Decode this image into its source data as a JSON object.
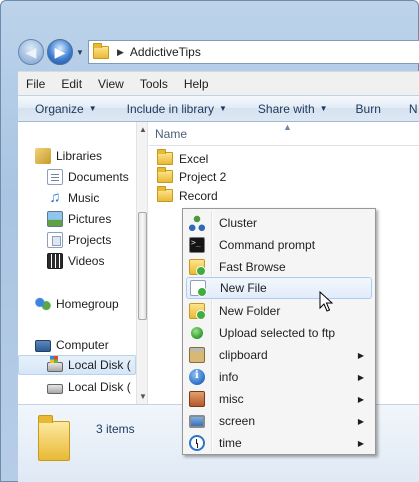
{
  "window": {
    "address": {
      "path_label": "AddictiveTips"
    },
    "menubar": [
      "File",
      "Edit",
      "View",
      "Tools",
      "Help"
    ],
    "commandbar": [
      {
        "label": "Organize",
        "dropdown": true
      },
      {
        "label": "Include in library",
        "dropdown": true
      },
      {
        "label": "Share with",
        "dropdown": true
      },
      {
        "label": "Burn",
        "dropdown": false
      },
      {
        "label": "N",
        "dropdown": false
      }
    ],
    "nav_pane": {
      "libraries_label": "Libraries",
      "library_items": [
        "Documents",
        "Music",
        "Pictures",
        "Projects",
        "Videos"
      ],
      "homegroup_label": "Homegroup",
      "computer_label": "Computer",
      "drives": [
        "Local Disk (",
        "Local Disk ("
      ]
    },
    "file_list": {
      "column_name": "Name",
      "items": [
        "Excel",
        "Project 2",
        "Record"
      ]
    },
    "details": {
      "count_text": "3 items"
    }
  },
  "context_menu": {
    "items": [
      {
        "label": "Cluster",
        "icon": "cluster-icon",
        "submenu": false
      },
      {
        "label": "Command prompt",
        "icon": "command-prompt-icon",
        "submenu": false
      },
      {
        "label": "Fast Browse",
        "icon": "fast-browse-icon",
        "submenu": false
      },
      {
        "label": "New File",
        "icon": "new-file-icon",
        "submenu": false,
        "highlighted": true
      },
      {
        "label": "New Folder",
        "icon": "new-folder-icon",
        "submenu": false
      },
      {
        "label": "Upload selected to ftp",
        "icon": "ftp-upload-icon",
        "submenu": false
      },
      {
        "label": "clipboard",
        "icon": "clipboard-icon",
        "submenu": true
      },
      {
        "label": "info",
        "icon": "info-icon",
        "submenu": true
      },
      {
        "label": "misc",
        "icon": "misc-icon",
        "submenu": true
      },
      {
        "label": "screen",
        "icon": "screen-icon",
        "submenu": true
      },
      {
        "label": "time",
        "icon": "time-icon",
        "submenu": true
      }
    ]
  },
  "colors": {
    "window_frame": "#a9c4e2",
    "command_bar_text": "#1e395b",
    "menu_highlight_border": "#aeccf1"
  }
}
